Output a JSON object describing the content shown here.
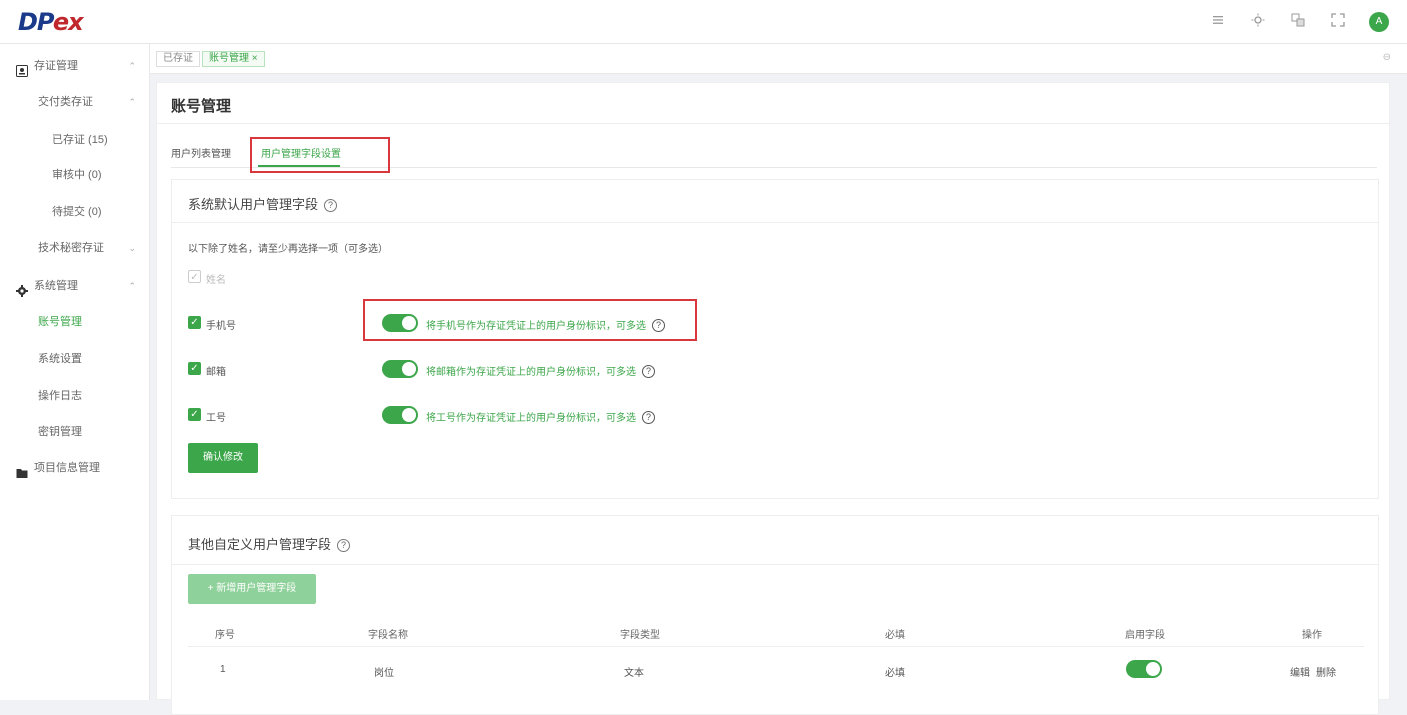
{
  "brand": {
    "logo_d": "D",
    "logo_p": "P",
    "logo_ex": "ex"
  },
  "header": {
    "icons": [
      "menu-icon",
      "sun-icon",
      "translate-icon",
      "fullscreen-icon"
    ],
    "avatar_text": "A"
  },
  "sidebar": {
    "items": [
      {
        "label": "存证管理",
        "icon": "certificate-icon",
        "expanded": true
      },
      {
        "label": "交付类存证",
        "expanded": true
      },
      {
        "label": "已存证 (15)"
      },
      {
        "label": "审核中 (0)"
      },
      {
        "label": "待提交 (0)"
      },
      {
        "label": "技术秘密存证",
        "expanded": false
      },
      {
        "label": "系统管理",
        "icon": "gear-icon",
        "expanded": true
      },
      {
        "label": "账号管理",
        "active": true
      },
      {
        "label": "系统设置"
      },
      {
        "label": "操作日志"
      },
      {
        "label": "密钥管理"
      },
      {
        "label": "项目信息管理",
        "icon": "folder-icon"
      }
    ],
    "arrow_up": "⌃",
    "arrow_down": "⌄"
  },
  "tabs": {
    "items": [
      {
        "label": "已存证"
      },
      {
        "label": "账号管理 ×",
        "active": true
      }
    ],
    "more": "⊖"
  },
  "page": {
    "title": "账号管理",
    "subtabs": [
      {
        "label": "用户列表管理"
      },
      {
        "label": "用户管理字段设置",
        "active": true
      }
    ]
  },
  "default_fields": {
    "title": "系统默认用户管理字段",
    "help": "?",
    "hint": "以下除了姓名，请至少再选择一项（可多选）",
    "fields": [
      {
        "label": "姓名",
        "checked": true,
        "disabled": true
      },
      {
        "label": "手机号",
        "checked": true,
        "toggle_on": true,
        "toggle_label": "将手机号作为存证凭证上的用户身份标识，可多选"
      },
      {
        "label": "邮箱",
        "checked": true,
        "toggle_on": true,
        "toggle_label": "将邮箱作为存证凭证上的用户身份标识，可多选"
      },
      {
        "label": "工号",
        "checked": true,
        "toggle_on": true,
        "toggle_label": "将工号作为存证凭证上的用户身份标识，可多选"
      }
    ],
    "confirm_button": "确认修改",
    "check_mark": "✓"
  },
  "custom_fields": {
    "title": "其他自定义用户管理字段",
    "help": "?",
    "add_button": "+ 新增用户管理字段",
    "columns": [
      "序号",
      "字段名称",
      "字段类型",
      "必填",
      "启用字段",
      "操作"
    ],
    "rows": [
      {
        "index": "1",
        "name": "岗位",
        "type": "文本",
        "required": "必填",
        "enabled": true,
        "actions": [
          "编辑",
          "删除"
        ]
      }
    ]
  },
  "colors": {
    "accent": "#3ca64a",
    "highlight": "#d9363e",
    "brand_blue": "#1b3a8a",
    "brand_red": "#c0282d"
  }
}
